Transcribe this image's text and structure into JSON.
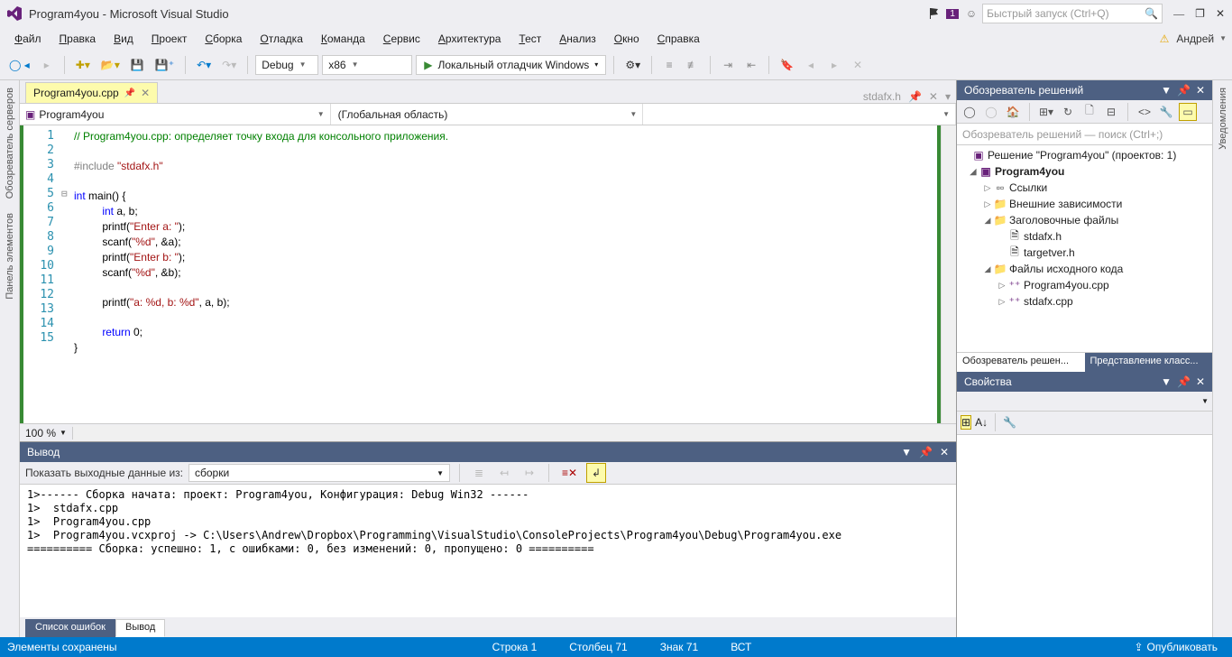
{
  "title": "Program4you - Microsoft Visual Studio",
  "notification_count": "1",
  "quick_launch_placeholder": "Быстрый запуск (Ctrl+Q)",
  "user_name": "Андрей",
  "menu": {
    "file": "Файл",
    "edit": "Правка",
    "view": "Вид",
    "project": "Проект",
    "build": "Сборка",
    "debug": "Отладка",
    "team": "Команда",
    "tools": "Сервис",
    "arch": "Архитектура",
    "test": "Тест",
    "analyze": "Анализ",
    "window": "Окно",
    "help": "Справка"
  },
  "toolbar": {
    "config": "Debug",
    "platform": "x86",
    "start_label": "Локальный отладчик Windows"
  },
  "tabs": {
    "active_file": "Program4you.cpp",
    "right_file": "stdafx.h"
  },
  "nav": {
    "scope": "Program4you",
    "func": "(Глобальная область)"
  },
  "code": {
    "l1": "// Program4you.cpp: определяет точку входа для консольного приложения.",
    "l3a": "#include ",
    "l3b": "\"stdafx.h\"",
    "l5a": "int",
    "l5b": " main() {",
    "l6a": "int",
    "l6b": " a, b;",
    "l7a": "printf(",
    "l7b": "\"Enter a: \"",
    "l7c": ");",
    "l8a": "scanf(",
    "l8b": "\"%d\"",
    "l8c": ", &a);",
    "l9a": "printf(",
    "l9b": "\"Enter b: \"",
    "l9c": ");",
    "l10a": "scanf(",
    "l10b": "\"%d\"",
    "l10c": ", &b);",
    "l12a": "printf(",
    "l12b": "\"a: %d, b: %d\"",
    "l12c": ", a, b);",
    "l14a": "return",
    "l14b": " 0;",
    "l15": "}"
  },
  "line_numbers": [
    "1",
    "2",
    "3",
    "4",
    "5",
    "6",
    "7",
    "8",
    "9",
    "10",
    "11",
    "12",
    "13",
    "14",
    "15"
  ],
  "zoom": "100 %",
  "output": {
    "title": "Вывод",
    "show_from_label": "Показать выходные данные из:",
    "show_from_value": "сборки",
    "lines": [
      "1>------ Сборка начата: проект: Program4you, Конфигурация: Debug Win32 ------",
      "1>  stdafx.cpp",
      "1>  Program4you.cpp",
      "1>  Program4you.vcxproj -> C:\\Users\\Andrew\\Dropbox\\Programming\\VisualStudio\\ConsoleProjects\\Program4you\\Debug\\Program4you.exe",
      "========== Сборка: успешно: 1, с ошибками: 0, без изменений: 0, пропущено: 0 =========="
    ]
  },
  "bottom_tabs": {
    "errors": "Список ошибок",
    "output": "Вывод"
  },
  "solution": {
    "header": "Обозреватель решений",
    "search_placeholder": "Обозреватель решений — поиск (Ctrl+;)",
    "root": "Решение \"Program4you\" (проектов: 1)",
    "project": "Program4you",
    "refs": "Ссылки",
    "ext": "Внешние зависимости",
    "headers": "Заголовочные файлы",
    "h1": "stdafx.h",
    "h2": "targetver.h",
    "src": "Файлы исходного кода",
    "s1": "Program4you.cpp",
    "s2": "stdafx.cpp",
    "tab_explorer": "Обозреватель решен...",
    "tab_class": "Представление класс..."
  },
  "props": {
    "header": "Свойства"
  },
  "left_rails": {
    "servers": "Обозреватель серверов",
    "toolbox": "Панель элементов"
  },
  "right_rails": {
    "notifications": "Уведомления"
  },
  "status": {
    "ready": "Элементы сохранены",
    "line": "Строка 1",
    "col": "Столбец 71",
    "char": "Знак 71",
    "ins": "ВСТ",
    "publish": "Опубликовать"
  }
}
